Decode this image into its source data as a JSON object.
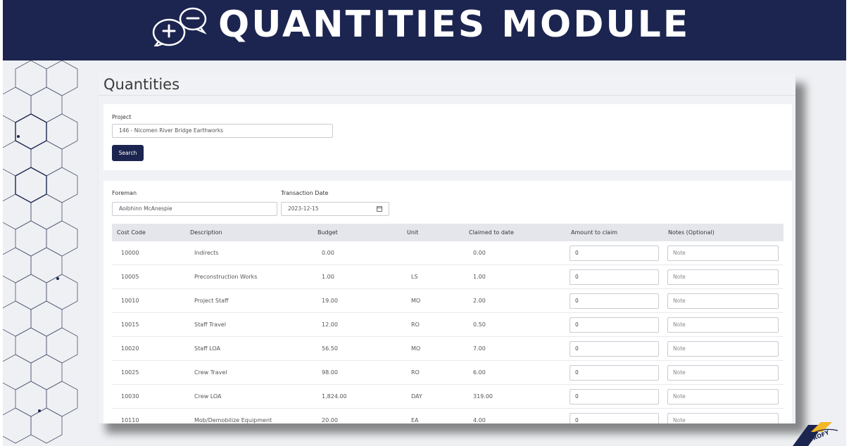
{
  "banner": {
    "title": "QUANTITIES MODULE",
    "icon": "speech-bubbles-plus-minus-icon"
  },
  "page": {
    "title": "Quantities"
  },
  "project": {
    "label": "Project",
    "value": "146 - Nicomen River Bridge Earthworks"
  },
  "search": {
    "label": "Search"
  },
  "foreman": {
    "label": "Foreman",
    "value": "Aoibhinn McAnespie"
  },
  "transaction": {
    "label": "Transaction Date",
    "value": "2023-12-15",
    "icon": "calendar-icon"
  },
  "table": {
    "headers": {
      "cost_code": "Cost Code",
      "description": "Description",
      "budget": "Budget",
      "unit": "Unit",
      "claimed": "Claimed to date",
      "amount": "Amount to claim",
      "notes": "Notes (Optional)"
    },
    "rows": [
      {
        "code": "10000",
        "desc": "Indirects",
        "budget": "0.00",
        "unit": "",
        "claimed": "0.00",
        "amount": "0",
        "note": "Note"
      },
      {
        "code": "10005",
        "desc": "Preconstruction Works",
        "budget": "1.00",
        "unit": "LS",
        "claimed": "1.00",
        "amount": "0",
        "note": "Note"
      },
      {
        "code": "10010",
        "desc": "Project Staff",
        "budget": "19.00",
        "unit": "MO",
        "claimed": "2.00",
        "amount": "0",
        "note": "Note"
      },
      {
        "code": "10015",
        "desc": "Staff Travel",
        "budget": "12.00",
        "unit": "RO",
        "claimed": "0.50",
        "amount": "0",
        "note": "Note"
      },
      {
        "code": "10020",
        "desc": "Staff LOA",
        "budget": "56.50",
        "unit": "MO",
        "claimed": "7.00",
        "amount": "0",
        "note": "Note"
      },
      {
        "code": "10025",
        "desc": "Crew Travel",
        "budget": "98.00",
        "unit": "RO",
        "claimed": "6.00",
        "amount": "0",
        "note": "Note"
      },
      {
        "code": "10030",
        "desc": "Crew LOA",
        "budget": "1,824.00",
        "unit": "DAY",
        "claimed": "319.00",
        "amount": "0",
        "note": "Note"
      },
      {
        "code": "10110",
        "desc": "Mob/Demobilize Equipment",
        "budget": "20.00",
        "unit": "EA",
        "claimed": "4.00",
        "amount": "0",
        "note": "Note"
      }
    ]
  },
  "logo": {
    "text": "TROFY"
  },
  "colors": {
    "navy": "#1c2550",
    "accent_yellow": "#f2b826"
  }
}
